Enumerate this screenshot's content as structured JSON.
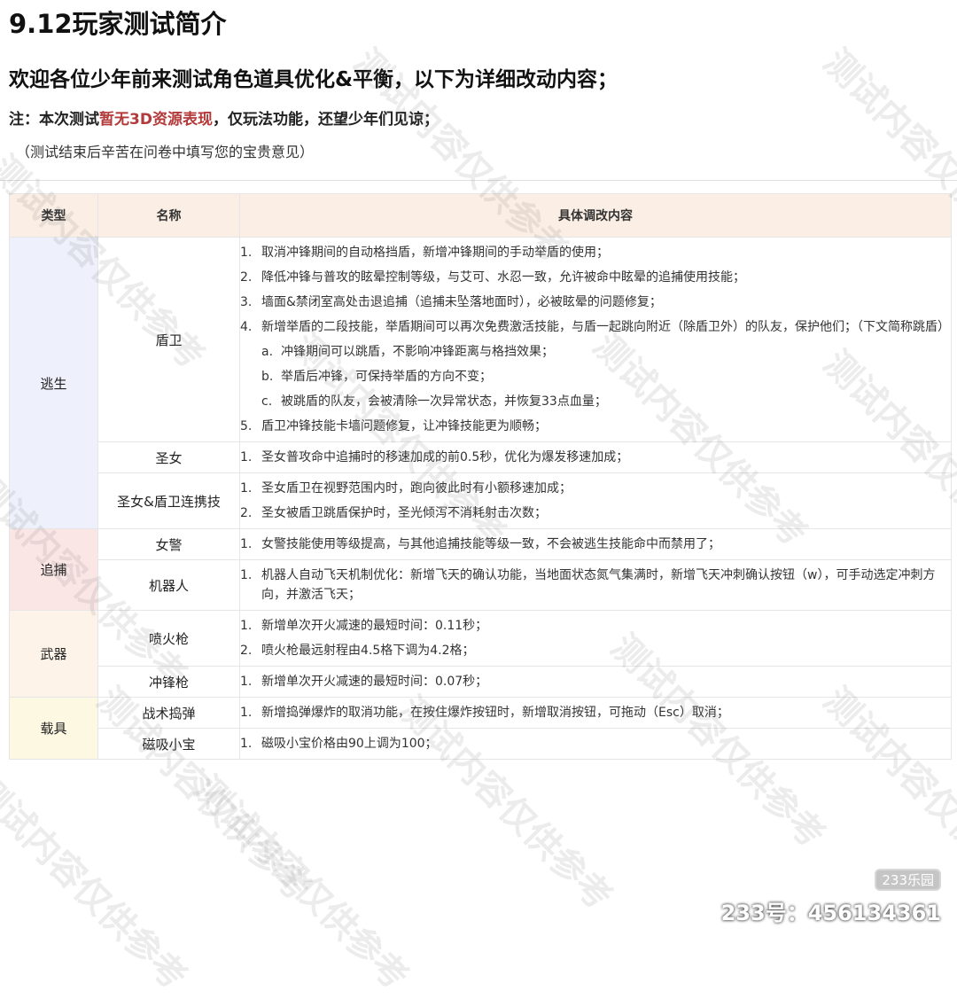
{
  "title": "9.12玩家测试简介",
  "heading": "欢迎各位少年前来测试角色道具优化&平衡，以下为详细改动内容；",
  "note": {
    "prefix": "注：本次测试",
    "highlight": "暂无3D资源表现",
    "suffix": "，仅玩法功能，还望少年们见谅；"
  },
  "subnote": "（测试结束后辛苦在问卷中填写您的宝贵意见）",
  "table": {
    "headers": [
      "类型",
      "名称",
      "具体调改内容"
    ],
    "groups": [
      {
        "type": "逃生",
        "rows": [
          {
            "name": "盾卫",
            "items": [
              {
                "num": "1.",
                "text": "取消冲锋期间的自动格挡盾，新增冲锋期间的手动举盾的使用；"
              },
              {
                "num": "2.",
                "text": "降低冲锋与普攻的眩晕控制等级，与艾可、水忍一致，允许被命中眩晕的追捕使用技能；"
              },
              {
                "num": "3.",
                "text": "墙面&禁闭室高处击退追捕（追捕未坠落地面时），必被眩晕的问题修复；"
              },
              {
                "num": "4.",
                "text": "新增举盾的二段技能，举盾期间可以再次免费激活技能，与盾一起跳向附近（除盾卫外）的队友，保护他们；（下文简称跳盾）"
              },
              {
                "num": "a.",
                "text": "冲锋期间可以跳盾，不影响冲锋距离与格挡效果；",
                "sub": true
              },
              {
                "num": "b.",
                "text": "举盾后冲锋，可保持举盾的方向不变；",
                "sub": true
              },
              {
                "num": "c.",
                "text": "被跳盾的队友，会被清除一次异常状态，并恢复33点血量；",
                "sub": true
              },
              {
                "num": "5.",
                "text": "盾卫冲锋技能卡墙问题修复，让冲锋技能更为顺畅；"
              }
            ]
          },
          {
            "name": "圣女",
            "items": [
              {
                "num": "1.",
                "text": "圣女普攻命中追捕时的移速加成的前0.5秒，优化为爆发移速加成；"
              }
            ]
          },
          {
            "name": "圣女&盾卫连携技",
            "items": [
              {
                "num": "1.",
                "text": "圣女盾卫在视野范围内时，跑向彼此时有小额移速加成；"
              },
              {
                "num": "2.",
                "text": "圣女被盾卫跳盾保护时，圣光倾泻不消耗射击次数；"
              }
            ]
          }
        ]
      },
      {
        "type": "追捕",
        "rows": [
          {
            "name": "女警",
            "items": [
              {
                "num": "1.",
                "text": "女警技能使用等级提高，与其他追捕技能等级一致，不会被逃生技能命中而禁用了；"
              }
            ]
          },
          {
            "name": "机器人",
            "items": [
              {
                "num": "1.",
                "text": "机器人自动飞天机制优化：新增飞天的确认功能，当地面状态氮气集满时，新增飞天冲刺确认按钮（w），可手动选定冲刺方向，并激活飞天；"
              }
            ]
          }
        ]
      },
      {
        "type": "武器",
        "rows": [
          {
            "name": "喷火枪",
            "items": [
              {
                "num": "1.",
                "text": "新增单次开火减速的最短时间：0.11秒；"
              },
              {
                "num": "2.",
                "text": "喷火枪最远射程由4.5格下调为4.2格；"
              }
            ]
          },
          {
            "name": "冲锋枪",
            "items": [
              {
                "num": "1.",
                "text": "新增单次开火减速的最短时间：0.07秒；"
              }
            ]
          }
        ]
      },
      {
        "type": "载具",
        "rows": [
          {
            "name": "战术捣弹",
            "items": [
              {
                "num": "1.",
                "text": "新增捣弹爆炸的取消功能，在按住爆炸按钮时，新增取消按钮，可拖动（Esc）取消；"
              }
            ]
          },
          {
            "name": "磁吸小宝",
            "items": [
              {
                "num": "1.",
                "text": "磁吸小宝价格由90上调为100；"
              }
            ]
          }
        ]
      }
    ]
  },
  "watermark_text": "测试内容仅供参考",
  "logo_badge": "233乐园",
  "account_id": "233号：456134361"
}
